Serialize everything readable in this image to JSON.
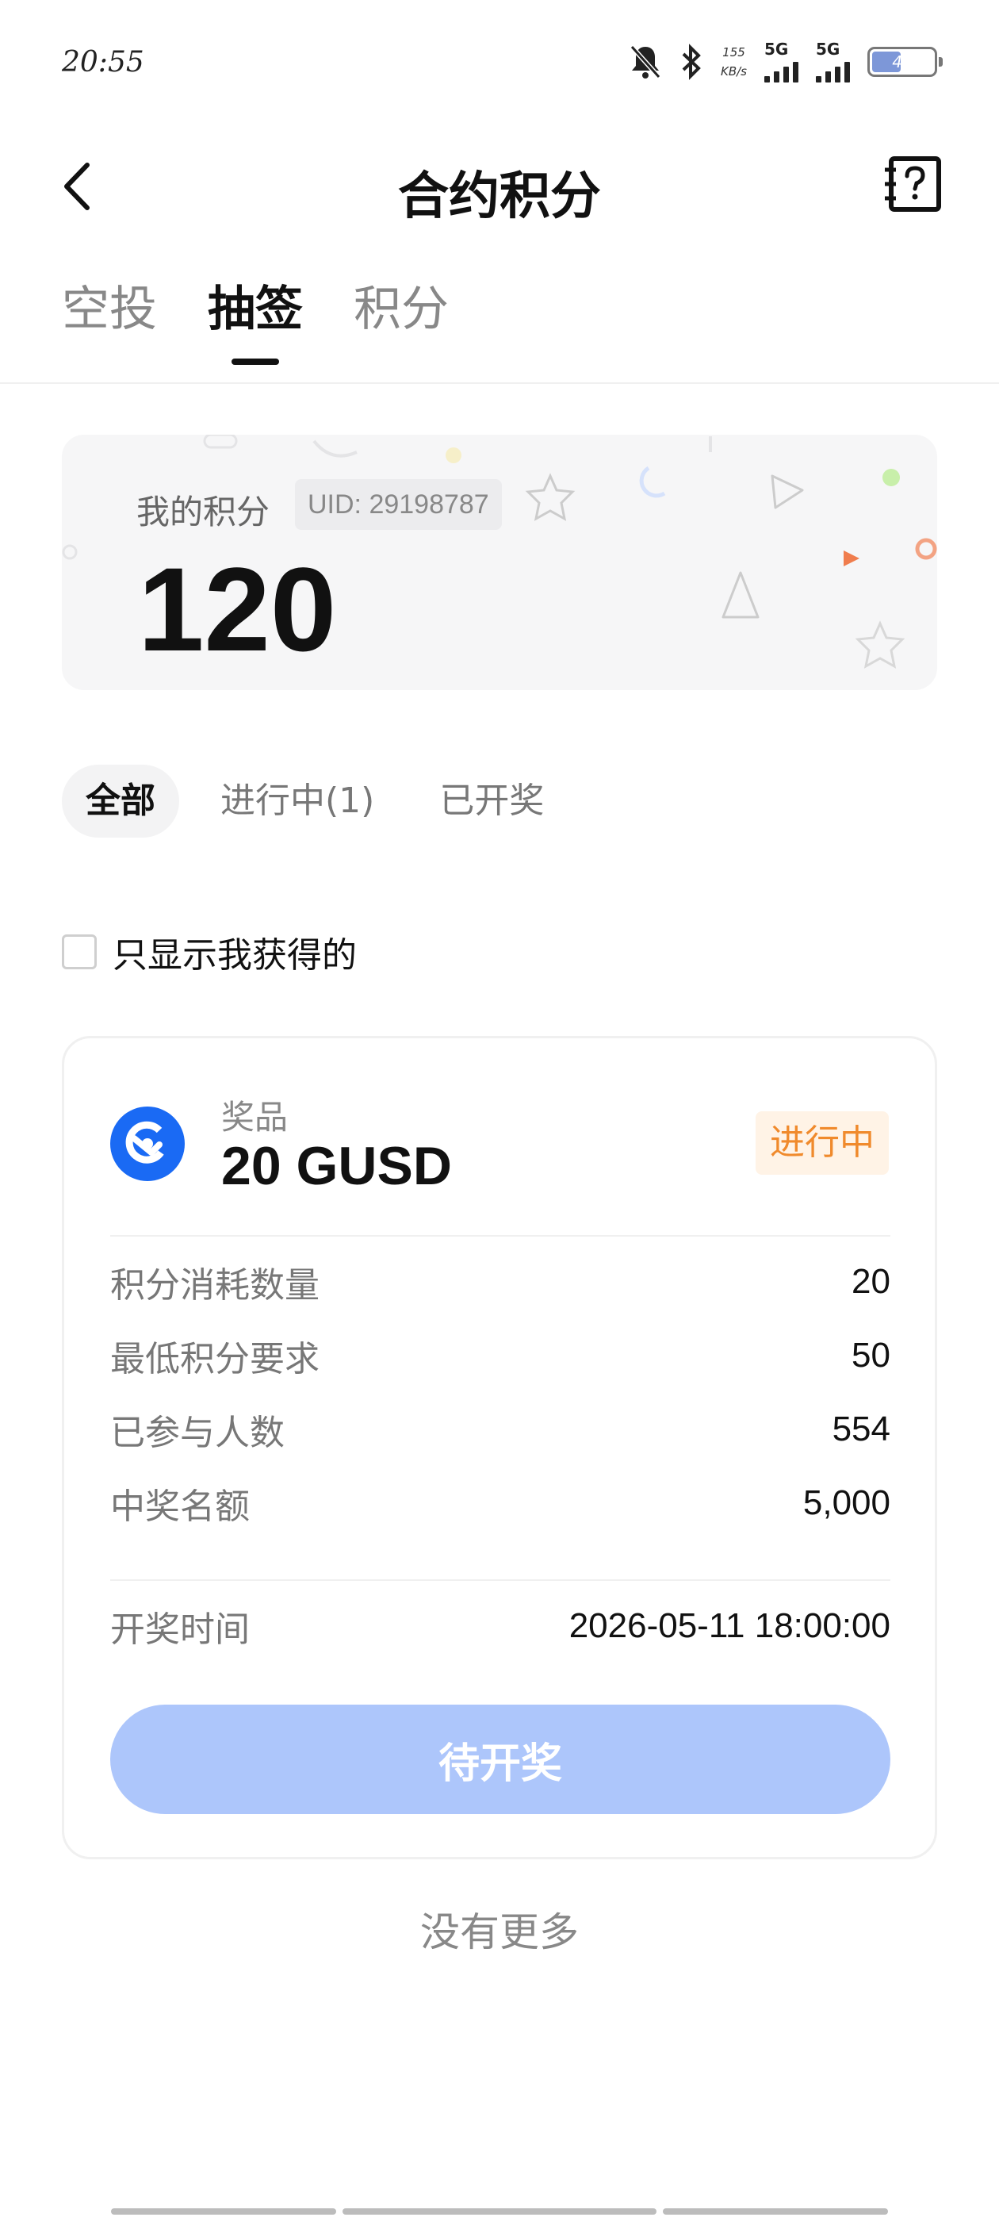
{
  "status_bar": {
    "time": "20:55",
    "net_speed_value": "155",
    "net_speed_unit": "KB/s",
    "signal_1_label": "5G",
    "signal_2_label": "5G",
    "battery_level": "48"
  },
  "nav": {
    "title": "合约积分"
  },
  "top_tabs": [
    {
      "label": "空投"
    },
    {
      "label": "抽签"
    },
    {
      "label": "积分"
    }
  ],
  "points_card": {
    "label": "我的积分",
    "uid": "UID: 29198787",
    "points": "120"
  },
  "filters": [
    {
      "label": "全部"
    },
    {
      "label": "进行中(1)"
    },
    {
      "label": "已开奖"
    }
  ],
  "only_mine": {
    "label": "只显示我获得的",
    "checked": false
  },
  "lottery": {
    "prize_label": "奖品",
    "prize_value": "20 GUSD",
    "status": "进行中",
    "rows": [
      {
        "label": "积分消耗数量",
        "value": "20"
      },
      {
        "label": "最低积分要求",
        "value": "50"
      },
      {
        "label": "已参与人数",
        "value": "554"
      },
      {
        "label": "中奖名额",
        "value": "5,000"
      }
    ],
    "draw_time_label": "开奖时间",
    "draw_time_value": "2026-05-11 18:00:00",
    "button_label": "待开奖"
  },
  "footer": {
    "no_more": "没有更多"
  },
  "colors": {
    "accent_blue": "#1a6af4",
    "button_disabled": "#adc6fb",
    "status_orange": "#f08a2c",
    "status_bg": "#fff3e6"
  }
}
